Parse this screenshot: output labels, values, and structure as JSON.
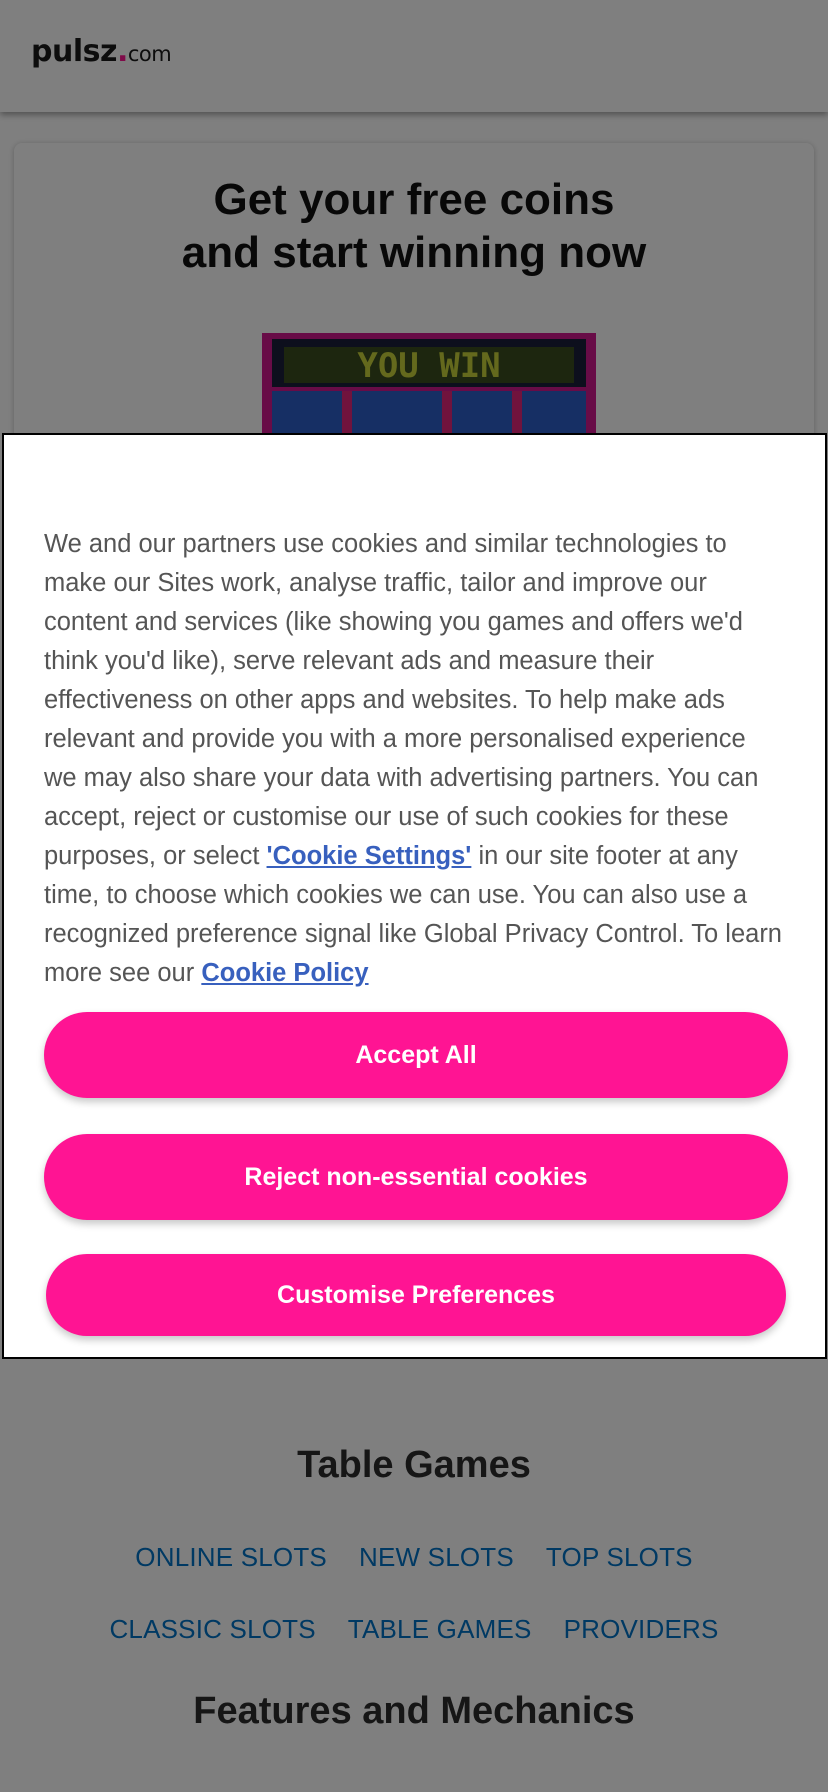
{
  "header": {
    "logo_main": "pulsz",
    "logo_dot": ".",
    "logo_tld": "com"
  },
  "promo": {
    "title_part1": "Get your ",
    "title_bold1": "free coins",
    "title_part2": "and ",
    "title_bold2": "start winning",
    "title_part3": " now",
    "marquee_text": "YOU WIN"
  },
  "cookie_dialog": {
    "text_part1": "We and our partners use cookies and similar technologies to make our Sites work, analyse traffic, tailor and improve our content and services (like showing you games and offers we'd think you'd like), serve relevant ads and measure their effectiveness on other apps and websites. To help make ads relevant and provide you with a more personalised experience we may also share your data with advertising partners. You can accept, reject or customise our use of such cookies for these purposes, or select ",
    "cookie_settings_link": "'Cookie Settings'",
    "text_part2": " in our site footer at any time, to choose which cookies we can use. You can also use a recognized preference signal like Global Privacy Control. To learn more see our ",
    "cookie_policy_link": "Cookie Policy",
    "accept_label": "Accept All",
    "reject_label": "Reject non-essential cookies",
    "customise_label": "Customise Preferences"
  },
  "lower": {
    "heading_table_games": "Table Games",
    "links_row1": [
      "ONLINE SLOTS",
      "NEW SLOTS",
      "TOP SLOTS"
    ],
    "links_row2": [
      "CLASSIC SLOTS",
      "TABLE GAMES",
      "PROVIDERS"
    ],
    "heading_features": "Features and Mechanics"
  },
  "colors": {
    "accent": "#ff1493",
    "link": "#0073c6",
    "policy_link": "#3860be"
  }
}
